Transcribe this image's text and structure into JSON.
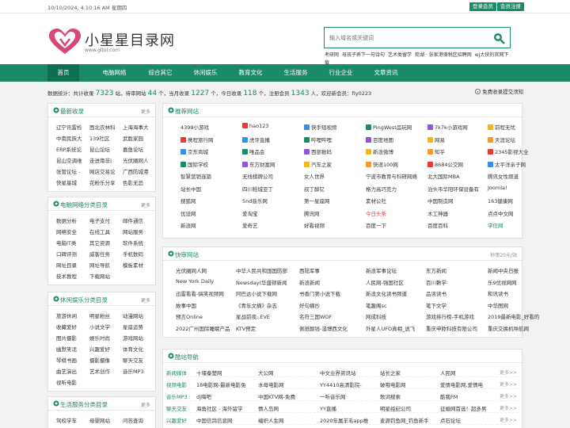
{
  "topbar": {
    "date": "10/10/2024, 4:10:16 AM 星期四",
    "login": "登录会员",
    "register": "会员注册"
  },
  "header": {
    "logo_text": "小星星目录网",
    "logo_url": "www.gltol.com",
    "search_placeholder": "输入域名或关键词",
    "hot": [
      "考研网",
      "母孩子养下一句诗句",
      "艺术类留学",
      "菀湖 · 张家港保税区招聘网",
      "wj大侠的官网下载"
    ]
  },
  "nav": [
    "首页",
    "电脑网络",
    "综合其它",
    "休闲娱乐",
    "教育文化",
    "生活服务",
    "行业企业",
    "文章资讯"
  ],
  "stats": {
    "l1": "数据统计：共计收录",
    "total": "7323",
    "l2": "站，待审网站",
    "pending": "44",
    "l3": "个，当月收录",
    "month": "1227",
    "l4": "个，今日收录",
    "today": "118",
    "l5": "个，注册会员",
    "members": "1343",
    "l6": "人，欢迎新会员：fiy0223",
    "free": "免费收录提交须知"
  },
  "sidebar": [
    {
      "title": "最新收录",
      "more": "更多",
      "items": [
        "辽宁讯雷检",
        "西北农林科",
        "上海海事大",
        "中南民族大",
        "139社区",
        "武胜家园",
        "ERP系统论",
        "昆山论坛",
        "嘉鱼论坛",
        "昆山空调维",
        "走进南非|",
        "光伏圈网人",
        "张管论坛 -",
        "网店交易论",
        "广西防城港",
        "快星基城",
        "花粉乐分享",
        "色影无忌"
      ]
    },
    {
      "title": "电脑网络分类目录",
      "more": "更多",
      "items": [
        "数据分析",
        "电子支付",
        "邮件通信",
        "网络安全",
        "在线工具",
        "网站服务",
        "电脑IT类",
        "其它资源",
        "软件系统",
        "口碑评测",
        "威客任务",
        "手机数码",
        "网址目录",
        "网址导航",
        "模板素材",
        "技术教程",
        "下载网站",
        ""
      ]
    },
    {
      "title": "休闲娱乐分类目录",
      "more": "更多",
      "items": [
        "旅游休闲",
        "明星粉丝",
        "动漫网站",
        "收藏爱好",
        "小说文学",
        "星座运势",
        "图片摄影",
        "娱乐时尚",
        "游戏网站",
        "幽默笑话",
        "兴趣爱好",
        "体育文化",
        "琴棋书画",
        "摄影摄像",
        "聊天交友",
        "曲艺演出",
        "艺术创作",
        "音乐MP3",
        "视听电影",
        "",
        ""
      ]
    },
    {
      "title": "生活服务分类目录",
      "more": "更多",
      "items": [
        "驾校学车",
        "母婴网站",
        "问答查询"
      ]
    }
  ],
  "recommend": {
    "title": "推荐网站",
    "rows": [
      [
        "4399小游戏",
        "hao123",
        "快手短视频",
        "PingWest品玩网",
        "7k7k小游戏网",
        "前程无忧"
      ],
      [
        "携程旅行网",
        "虎牙直播",
        "哔哩哔哩",
        "百度地图",
        "网易",
        "天涯论坛"
      ],
      [
        "京东商城",
        "唯品会",
        "西部数码",
        "新浪微博",
        "知乎",
        "2345影视大全"
      ],
      [
        "国际学校",
        "东方财富网",
        "汽车之家",
        "快递100网",
        "8684公交网",
        "太平洋亲子网"
      ],
      [
        "智慧营销连锁",
        "无线棋牌公司",
        "女人世界",
        "宁波市教育与科研网络",
        "北大国际MBA",
        "腾讯女性频道"
      ],
      [
        "站长中国",
        "四川稻城亚丁",
        "叔丁醇钇",
        "格力高巧克力",
        "泊头市华阳环保设备有",
        "Joomla!"
      ],
      [
        "搜狐网",
        "5nd音乐网",
        "第一星座网",
        "素材公社",
        "中国制造网",
        "163健康网"
      ],
      [
        "优设网",
        "爱淘宝",
        "腾讯网",
        "今日头条",
        "木工神器",
        "点点中文网"
      ],
      [
        "新浪网",
        "爱奇艺",
        "好看视频",
        "百度一下",
        "百度百科",
        "学信网"
      ]
    ]
  },
  "quick": {
    "title": "快审网站",
    "more": "秒审20元/站",
    "rows": [
      [
        "光伏圈网人网",
        "中华人民共和国国防部",
        "西陆军事",
        "新浪军事论坛",
        "东方新闻",
        "新闻中央日报"
      ],
      [
        "New York Daily",
        "Newsday(华盛顿新闻",
        "新浪新闻",
        "人民网-强国社区",
        "百川數学",
        "乐9优视网网"
      ],
      [
        "迅雷看看-搞笑视频网",
        "阿巴达小说下载网",
        "书香门第小说下载",
        "新浪文化读书频道",
        "品读读书",
        "和讯读书"
      ],
      [
        "故事中国",
        "《青年文摘》杂志",
        "好句摘抄",
        "笔趣阁sc",
        "笔下文学",
        "中华图网"
      ],
      [
        "预言Online",
        "星战前夜: EVE",
        "名符三国WOF",
        "网成科技",
        "游戏排行榜-手机游戏",
        "2019最新电影_好看的"
      ],
      [
        "2022广州国际睡眠产品",
        "KTV预定",
        "佩斑酸钱-淄博西文化",
        "外星人UFO真相_说飞",
        "重庆申欧科技有限公司",
        "重庆交换机导航网"
      ]
    ]
  },
  "navi": {
    "title": "酷站导航",
    "rows": [
      {
        "cat": "新闻媒体",
        "items": [
          "十堰秦楚网",
          "大公网",
          "中文业界资讯站",
          "站长之家",
          "人民网"
        ]
      },
      {
        "cat": "视频电影",
        "items": [
          "18电影网-最新电影免",
          "水母电影网",
          "YY4410高清影院-",
          "破哦电影网",
          "爱情电影网,爱情电"
        ]
      },
      {
        "cat": "音乐MP3",
        "items": [
          "dj嗨吧",
          "中国KTV网-免费",
          "一听音乐网",
          "歌词搜索",
          "酷我FM"
        ]
      },
      {
        "cat": "聊天交友",
        "items": [
          "海角社区 - 海外留学",
          "情人岛网",
          "YY直播",
          "明星经纪公司",
          "征婚网首选！超多男"
        ]
      },
      {
        "cat": "兴趣爱好",
        "items": [
          "中国信鸽信息网",
          "编织人生网",
          "2020年属羊毛app推",
          "麦源钓鱼网_钓鱼新手",
          "点石论坛"
        ]
      }
    ],
    "more": "更多>>"
  },
  "colors": {
    "accent": "#1a8a68",
    "nav_active": "#0f6f52",
    "red": "#e23d3d",
    "logo_pink": "#d9467a"
  }
}
